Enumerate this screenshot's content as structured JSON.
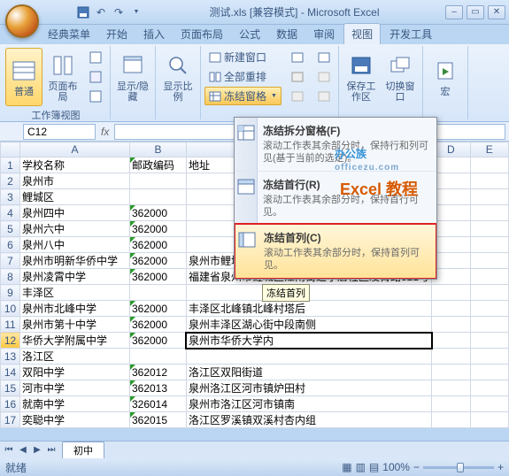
{
  "title": "测试.xls [兼容模式] - Microsoft Excel",
  "tabs": [
    "经典菜单",
    "开始",
    "插入",
    "页面布局",
    "公式",
    "数据",
    "审阅",
    "视图",
    "开发工具"
  ],
  "active_tab": "视图",
  "ribbon": {
    "normal": "普通",
    "page_layout": "页面布局",
    "group1": "工作簿视图",
    "show_hide": "显示/隐藏",
    "zoom": "显示比例",
    "new_window": "新建窗口",
    "arrange_all": "全部重排",
    "freeze_panes": "冻结窗格",
    "save_ws": "保存工作区",
    "switch_win": "切换窗口",
    "macros": "宏"
  },
  "namebox": "C12",
  "freeze_menu": {
    "item1_title": "冻结拆分窗格(F)",
    "item1_desc": "滚动工作表其余部分时，保持行和列可见(基于当前的选定)。",
    "item2_title": "冻结首行(R)",
    "item2_desc": "滚动工作表其余部分时，保持首行可见。",
    "item3_title": "冻结首列(C)",
    "item3_desc": "滚动工作表其余部分时，保持首列可见。"
  },
  "tooltip": "冻结首列",
  "watermark1": "办公族",
  "watermark1_sub": "officezu.com",
  "watermark2": "Excel 教程",
  "columns": [
    "",
    "A",
    "B",
    "C",
    "D",
    "E"
  ],
  "rows": [
    {
      "n": "1",
      "a": "学校名称",
      "b": "邮政编码",
      "c": "地址"
    },
    {
      "n": "2",
      "a": "泉州市"
    },
    {
      "n": "3",
      "a": "鲤城区"
    },
    {
      "n": "4",
      "a": "泉州四中",
      "b": "362000"
    },
    {
      "n": "5",
      "a": "泉州六中",
      "b": "362000"
    },
    {
      "n": "6",
      "a": "泉州八中",
      "b": "362000"
    },
    {
      "n": "7",
      "a": "泉州市明新华侨中学",
      "b": "362000",
      "c": "泉州市鲤城区江旁村红红山"
    },
    {
      "n": "8",
      "a": "泉州凌霄中学",
      "b": "362000",
      "c": "福建省泉州市鲤城区江南街道亭店社区凌霄路321号"
    },
    {
      "n": "9",
      "a": "丰泽区"
    },
    {
      "n": "10",
      "a": "泉州市北峰中学",
      "b": "362000",
      "c": "丰泽区北峰镇北峰村塔后"
    },
    {
      "n": "11",
      "a": "泉州市第十中学",
      "b": "362000",
      "c": "泉州丰泽区湖心街中段南侧"
    },
    {
      "n": "12",
      "a": "华侨大学附属中学",
      "b": "362000",
      "c": "泉州市华侨大学内"
    },
    {
      "n": "13",
      "a": "洛江区"
    },
    {
      "n": "14",
      "a": "双阳中学",
      "b": "362012",
      "c": "洛江区双阳街道"
    },
    {
      "n": "15",
      "a": "河市中学",
      "b": "362013",
      "c": "泉州洛江区河市镇炉田村"
    },
    {
      "n": "16",
      "a": "就南中学",
      "b": "326014",
      "c": "泉州市洛江区河市镇南"
    },
    {
      "n": "17",
      "a": "奕聪中学",
      "b": "362015",
      "c": "洛江区罗溪镇双溪村杏内组"
    }
  ],
  "sheet_tab": "初中",
  "status_text": "就绪",
  "zoom_pct": "100%"
}
